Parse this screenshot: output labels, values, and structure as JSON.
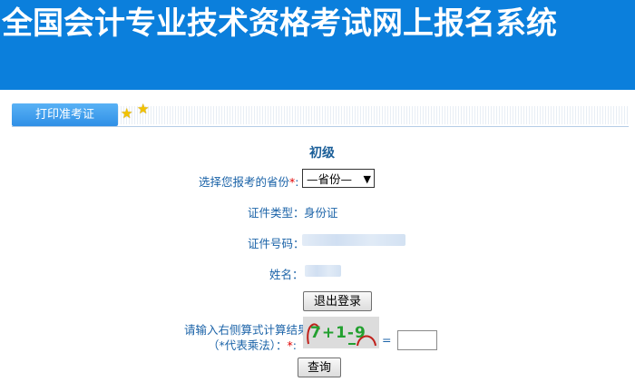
{
  "header": {
    "title": "全国会计专业技术资格考试网上报名系统"
  },
  "tabs": {
    "print_admission": "打印准考证"
  },
  "form": {
    "level": "初级",
    "province_label": "选择您报考的省份",
    "province_value": "—省份—",
    "required_mark": "*",
    "id_type_label": "证件类型：",
    "id_type_value": "身份证",
    "id_number_label": "证件号码：",
    "name_label": "姓名：",
    "logout_button": "退出登录",
    "captcha_label_line1": "请输入右侧算式计算结果",
    "captcha_label_line2": "（*代表乘法）：",
    "captcha_colon": ":",
    "captcha_expression": "7+1-9",
    "equals": "=",
    "query_button": "查询"
  },
  "colors": {
    "banner": "#0b7fdc",
    "tab": "#2f8fe6",
    "label": "#1b63a8",
    "required": "#e00000",
    "captcha_text": "#23a030"
  }
}
